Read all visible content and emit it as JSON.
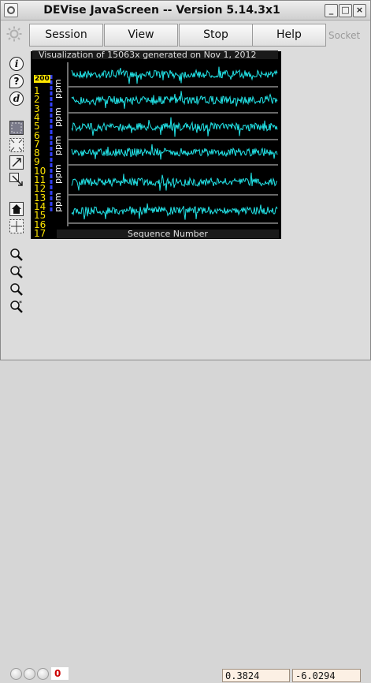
{
  "window": {
    "title": "DEVise JavaScreen -- Version 5.14.3x1",
    "controls": [
      "_",
      "□",
      "×"
    ]
  },
  "menu": {
    "buttons": [
      "Session",
      "View",
      "Stop",
      "Help"
    ],
    "socket_label": "Socket"
  },
  "toolbar": {
    "info_icon": "i",
    "help_icon": "?",
    "data_icon": "d"
  },
  "visualization": {
    "title": "Visualization of 15063x generated on Nov 1, 2012",
    "x_label": "Sequence Number",
    "y_axis_top_label": "200",
    "row_labels": [
      "1",
      "2",
      "3",
      "4",
      "5",
      "6",
      "7",
      "8",
      "9",
      "10",
      "11",
      "12",
      "13",
      "14",
      "15",
      "16",
      "17"
    ],
    "side_labels": [
      "ppm",
      "ppm",
      "ppm",
      "ppm",
      "ppm"
    ],
    "trace_color": "#22e4e8",
    "background": "#000000",
    "label_color": "#ffe600"
  },
  "status": {
    "counter": "0",
    "x_value": "0.3824",
    "y_value": "-6.0294"
  }
}
